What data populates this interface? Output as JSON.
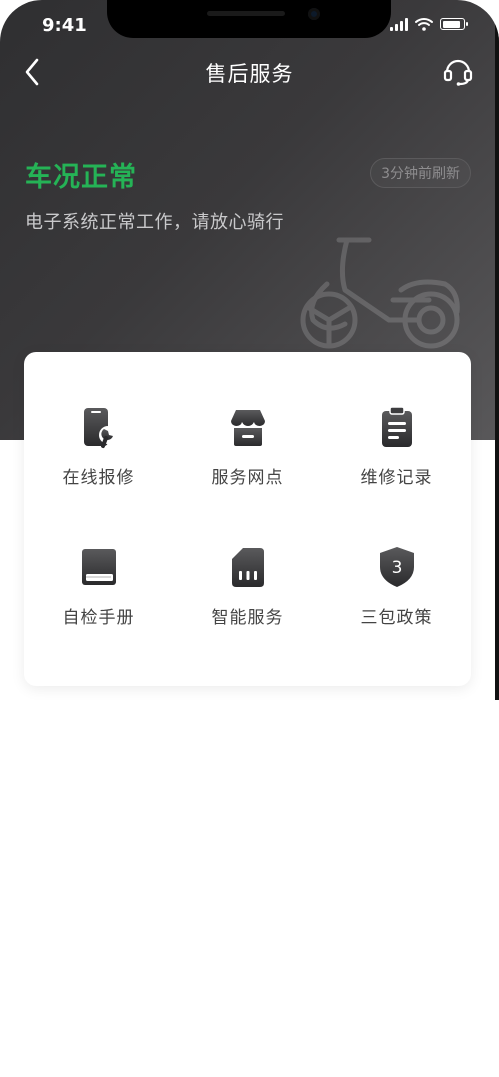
{
  "status_bar": {
    "time": "9:41"
  },
  "nav": {
    "title": "售后服务",
    "back_icon": "chevron-left-icon",
    "support_icon": "headset-icon"
  },
  "vehicle": {
    "status_title": "车况正常",
    "refresh_label": "3分钟前刷新",
    "description": "电子系统正常工作，请放心骑行",
    "status_color": "#25b356"
  },
  "services": [
    {
      "label": "在线报修",
      "icon": "phone-wrench-icon"
    },
    {
      "label": "服务网点",
      "icon": "store-icon"
    },
    {
      "label": "维修记录",
      "icon": "clipboard-icon"
    },
    {
      "label": "自检手册",
      "icon": "book-icon"
    },
    {
      "label": "智能服务",
      "icon": "sim-card-icon"
    },
    {
      "label": "三包政策",
      "icon": "shield-icon",
      "badge": "3"
    }
  ]
}
